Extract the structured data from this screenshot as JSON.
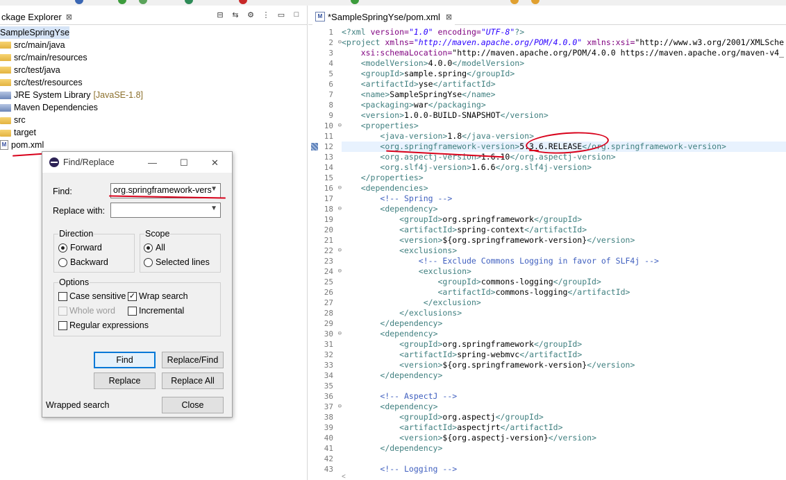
{
  "package_explorer": {
    "tab_label": "ckage Explorer",
    "tab_close": "⊠",
    "items": [
      {
        "label": "SampleSpringYse",
        "decoration": "",
        "icon": "project-icon"
      },
      {
        "label": "src/main/java",
        "decoration": "",
        "icon": "source-folder-icon"
      },
      {
        "label": "src/main/resources",
        "decoration": "",
        "icon": "source-folder-icon"
      },
      {
        "label": "src/test/java",
        "decoration": "",
        "icon": "source-folder-icon"
      },
      {
        "label": "src/test/resources",
        "decoration": "",
        "icon": "source-folder-icon"
      },
      {
        "label": "JRE System Library",
        "decoration": "[JavaSE-1.8]",
        "icon": "library-icon"
      },
      {
        "label": "Maven Dependencies",
        "decoration": "",
        "icon": "library-icon"
      },
      {
        "label": "src",
        "decoration": "",
        "icon": "folder-icon"
      },
      {
        "label": "target",
        "decoration": "",
        "icon": "folder-icon"
      },
      {
        "label": "pom.xml",
        "decoration": "",
        "icon": "xml-file-icon"
      }
    ]
  },
  "editor": {
    "tab_label": "*SampleSpringYse/pom.xml",
    "tab_close": "⊠",
    "line_numbers": [
      "1",
      "2",
      "3",
      "4",
      "5",
      "6",
      "7",
      "8",
      "9",
      "10",
      "11",
      "12",
      "13",
      "14",
      "15",
      "16",
      "17",
      "18",
      "19",
      "20",
      "21",
      "22",
      "23",
      "24",
      "25",
      "26",
      "27",
      "28",
      "29",
      "30",
      "31",
      "32",
      "33",
      "34",
      "35",
      "36",
      "37",
      "38",
      "39",
      "40",
      "41",
      "42",
      "43"
    ],
    "lines": [
      "<?xml version=\"1.0\" encoding=\"UTF-8\"?>",
      "<project xmlns=\"http://maven.apache.org/POM/4.0.0\" xmlns:xsi=\"http://www.w3.org/2001/XMLSche",
      "    xsi:schemaLocation=\"http://maven.apache.org/POM/4.0.0 https://maven.apache.org/maven-v4_",
      "    <modelVersion>4.0.0</modelVersion>",
      "    <groupId>sample.spring</groupId>",
      "    <artifactId>yse</artifactId>",
      "    <name>SampleSpringYse</name>",
      "    <packaging>war</packaging>",
      "    <version>1.0.0-BUILD-SNAPSHOT</version>",
      "    <properties>",
      "        <java-version>1.8</java-version>",
      "        <org.springframework-version>5.3.6.RELEASE</org.springframework-version>",
      "        <org.aspectj-version>1.6.10</org.aspectj-version>",
      "        <org.slf4j-version>1.6.6</org.slf4j-version>",
      "    </properties>",
      "    <dependencies>",
      "        <!-- Spring -->",
      "        <dependency>",
      "            <groupId>org.springframework</groupId>",
      "            <artifactId>spring-context</artifactId>",
      "            <version>${org.springframework-version}</version>",
      "            <exclusions>",
      "                <!-- Exclude Commons Logging in favor of SLF4j -->",
      "                <exclusion>",
      "                    <groupId>commons-logging</groupId>",
      "                    <artifactId>commons-logging</artifactId>",
      "                 </exclusion>",
      "            </exclusions>",
      "        </dependency>",
      "        <dependency>",
      "            <groupId>org.springframework</groupId>",
      "            <artifactId>spring-webmvc</artifactId>",
      "            <version>${org.springframework-version}</version>",
      "        </dependency>",
      "",
      "        <!-- AspectJ -->",
      "        <dependency>",
      "            <groupId>org.aspectj</groupId>",
      "            <artifactId>aspectjrt</artifactId>",
      "            <version>${org.aspectj-version}</version>",
      "        </dependency>",
      "",
      "        <!-- Logging -->"
    ],
    "scroll_left": "<"
  },
  "find_replace": {
    "title": "Find/Replace",
    "minimize": "—",
    "maximize": "☐",
    "close": "✕",
    "find_label": "Find:",
    "find_value": "org.springframework-vers",
    "replace_label": "Replace with:",
    "replace_value": "",
    "direction_title": "Direction",
    "forward": "Forward",
    "backward": "Backward",
    "scope_title": "Scope",
    "all": "All",
    "selected_lines": "Selected lines",
    "options_title": "Options",
    "case_sensitive": "Case sensitive",
    "wrap_search": "Wrap search",
    "whole_word": "Whole word",
    "incremental": "Incremental",
    "regular_expressions": "Regular expressions",
    "find_button": "Find",
    "replace_find_button": "Replace/Find",
    "replace_button": "Replace",
    "replace_all_button": "Replace All",
    "close_button": "Close",
    "status": "Wrapped search",
    "checkmark": "✓"
  }
}
